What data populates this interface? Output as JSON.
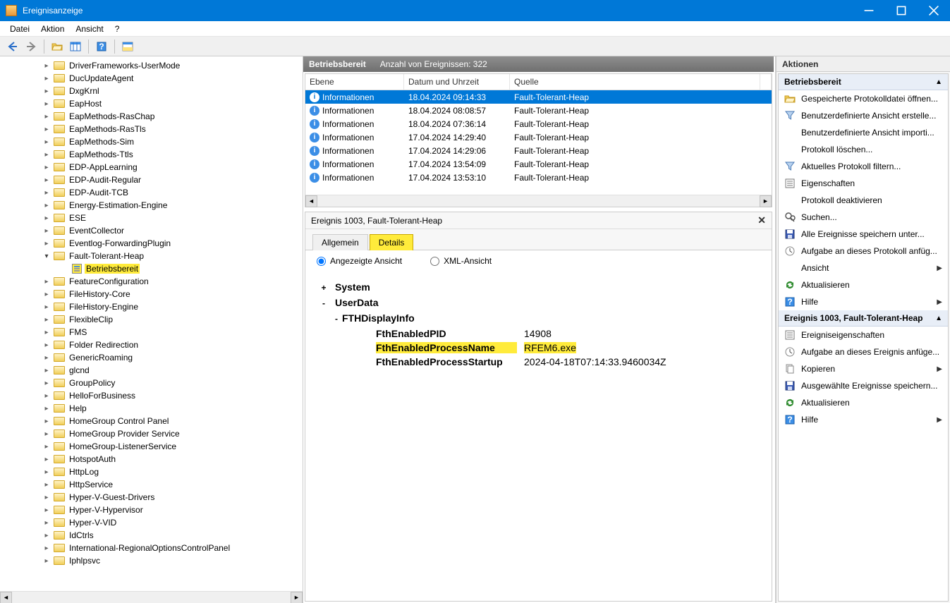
{
  "window": {
    "title": "Ereignisanzeige",
    "menus": [
      "Datei",
      "Aktion",
      "Ansicht",
      "?"
    ]
  },
  "toolbar": {
    "back": "back",
    "forward": "forward",
    "folder": "folder-open",
    "table": "table",
    "help": "help",
    "preview": "preview"
  },
  "tree": {
    "items": [
      {
        "label": "DriverFrameworks-UserMode"
      },
      {
        "label": "DucUpdateAgent"
      },
      {
        "label": "DxgKrnl"
      },
      {
        "label": "EapHost"
      },
      {
        "label": "EapMethods-RasChap"
      },
      {
        "label": "EapMethods-RasTls"
      },
      {
        "label": "EapMethods-Sim"
      },
      {
        "label": "EapMethods-Ttls"
      },
      {
        "label": "EDP-AppLearning"
      },
      {
        "label": "EDP-Audit-Regular"
      },
      {
        "label": "EDP-Audit-TCB"
      },
      {
        "label": "Energy-Estimation-Engine"
      },
      {
        "label": "ESE"
      },
      {
        "label": "EventCollector"
      },
      {
        "label": "Eventlog-ForwardingPlugin"
      },
      {
        "label": "Fault-Tolerant-Heap",
        "expanded": true
      },
      {
        "label": "Betriebsbereit",
        "child": true,
        "highlight": true
      },
      {
        "label": "FeatureConfiguration"
      },
      {
        "label": "FileHistory-Core"
      },
      {
        "label": "FileHistory-Engine"
      },
      {
        "label": "FlexibleClip"
      },
      {
        "label": "FMS"
      },
      {
        "label": "Folder Redirection"
      },
      {
        "label": "GenericRoaming"
      },
      {
        "label": "glcnd"
      },
      {
        "label": "GroupPolicy"
      },
      {
        "label": "HelloForBusiness"
      },
      {
        "label": "Help"
      },
      {
        "label": "HomeGroup Control Panel"
      },
      {
        "label": "HomeGroup Provider Service"
      },
      {
        "label": "HomeGroup-ListenerService"
      },
      {
        "label": "HotspotAuth"
      },
      {
        "label": "HttpLog"
      },
      {
        "label": "HttpService"
      },
      {
        "label": "Hyper-V-Guest-Drivers"
      },
      {
        "label": "Hyper-V-Hypervisor"
      },
      {
        "label": "Hyper-V-VID"
      },
      {
        "label": "IdCtrls"
      },
      {
        "label": "International-RegionalOptionsControlPanel"
      },
      {
        "label": "Iphlpsvc"
      }
    ]
  },
  "grid": {
    "header_title": "Betriebsbereit",
    "count_label": "Anzahl von Ereignissen: 322",
    "columns": [
      "Ebene",
      "Datum und Uhrzeit",
      "Quelle"
    ],
    "rows": [
      {
        "level": "Informationen",
        "datetime": "18.04.2024 09:14:33",
        "source": "Fault-Tolerant-Heap",
        "selected": true
      },
      {
        "level": "Informationen",
        "datetime": "18.04.2024 08:08:57",
        "source": "Fault-Tolerant-Heap"
      },
      {
        "level": "Informationen",
        "datetime": "18.04.2024 07:36:14",
        "source": "Fault-Tolerant-Heap"
      },
      {
        "level": "Informationen",
        "datetime": "17.04.2024 14:29:40",
        "source": "Fault-Tolerant-Heap"
      },
      {
        "level": "Informationen",
        "datetime": "17.04.2024 14:29:06",
        "source": "Fault-Tolerant-Heap"
      },
      {
        "level": "Informationen",
        "datetime": "17.04.2024 13:54:09",
        "source": "Fault-Tolerant-Heap"
      },
      {
        "level": "Informationen",
        "datetime": "17.04.2024 13:53:10",
        "source": "Fault-Tolerant-Heap"
      }
    ]
  },
  "detail": {
    "title": "Ereignis 1003, Fault-Tolerant-Heap",
    "tabs": {
      "general": "Allgemein",
      "details": "Details"
    },
    "view_opts": {
      "friendly": "Angezeigte Ansicht",
      "xml": "XML-Ansicht"
    },
    "tree": {
      "system": "System",
      "userdata": "UserData",
      "fthdisplay": "FTHDisplayInfo",
      "pid_k": "FthEnabledPID",
      "pid_v": "14908",
      "pname_k": "FthEnabledProcessName",
      "pname_v": "RFEM6.exe",
      "pstart_k": "FthEnabledProcessStartup",
      "pstart_v": "2024-04-18T07:14:33.9460034Z"
    }
  },
  "actions": {
    "title": "Aktionen",
    "section1": "Betriebsbereit",
    "section1_items": [
      {
        "icon": "open-log-icon",
        "label": "Gespeicherte Protokolldatei öffnen..."
      },
      {
        "icon": "create-view-icon",
        "label": "Benutzerdefinierte Ansicht erstelle..."
      },
      {
        "icon": "import-view-icon",
        "label": "Benutzerdefinierte Ansicht importi..."
      },
      {
        "icon": "clear-log-icon",
        "label": "Protokoll löschen..."
      },
      {
        "icon": "filter-icon",
        "label": "Aktuelles Protokoll filtern..."
      },
      {
        "icon": "properties-icon",
        "label": "Eigenschaften"
      },
      {
        "icon": "disable-log-icon",
        "label": "Protokoll deaktivieren"
      },
      {
        "icon": "find-icon",
        "label": "Suchen..."
      },
      {
        "icon": "save-all-icon",
        "label": "Alle Ereignisse speichern unter..."
      },
      {
        "icon": "attach-task-icon",
        "label": "Aufgabe an dieses Protokoll anfüg..."
      },
      {
        "icon": "view-icon",
        "label": "Ansicht",
        "arrow": true
      },
      {
        "icon": "refresh-icon",
        "label": "Aktualisieren"
      },
      {
        "icon": "help-icon",
        "label": "Hilfe",
        "arrow": true
      }
    ],
    "section2": "Ereignis 1003, Fault-Tolerant-Heap",
    "section2_items": [
      {
        "icon": "event-props-icon",
        "label": "Ereigniseigenschaften"
      },
      {
        "icon": "attach-task-event-icon",
        "label": "Aufgabe an dieses Ereignis anfüge..."
      },
      {
        "icon": "copy-icon",
        "label": "Kopieren",
        "arrow": true
      },
      {
        "icon": "save-selected-icon",
        "label": "Ausgewählte Ereignisse speichern..."
      },
      {
        "icon": "refresh-icon",
        "label": "Aktualisieren"
      },
      {
        "icon": "help-icon",
        "label": "Hilfe",
        "arrow": true
      }
    ]
  }
}
